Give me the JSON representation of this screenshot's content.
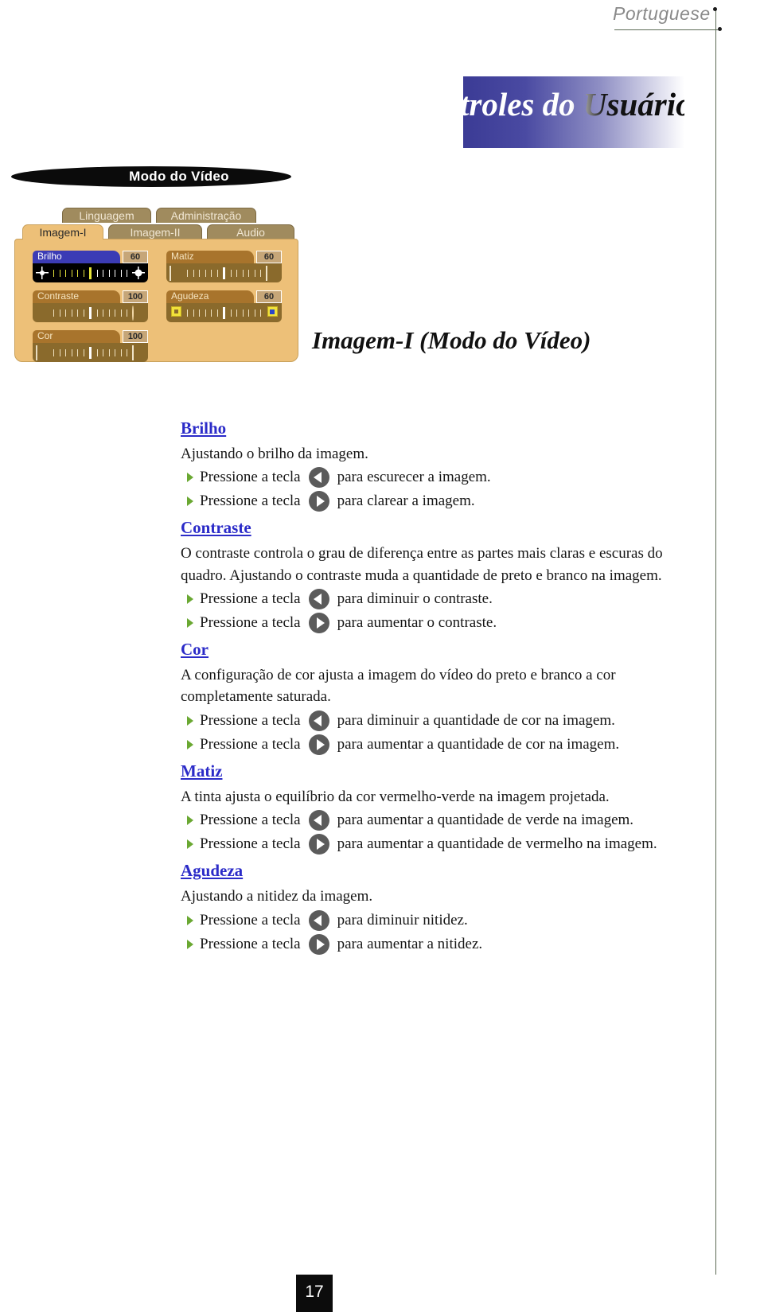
{
  "header": {
    "language_label": "Portuguese",
    "banner_title": "troles do Usuário",
    "mode_banner": "Modo do Vídeo"
  },
  "osd": {
    "tabs": [
      {
        "label": "Linguagem",
        "active": false
      },
      {
        "label": "Administração",
        "active": false
      },
      {
        "label": "Imagem-I",
        "active": true
      },
      {
        "label": "Imagem-II",
        "active": false
      },
      {
        "label": "Audio",
        "active": false
      }
    ],
    "sliders": [
      {
        "name": "Brilho",
        "value": "60",
        "selected": true
      },
      {
        "name": "Contraste",
        "value": "100",
        "selected": false
      },
      {
        "name": "Cor",
        "value": "100",
        "selected": false
      },
      {
        "name": "Matiz",
        "value": "60",
        "selected": false
      },
      {
        "name": "Agudeza",
        "value": "60",
        "selected": false
      }
    ]
  },
  "section_title": "Imagem-I (Modo do Vídeo)",
  "topics": [
    {
      "heading": "Brilho",
      "paragraphs": [
        "Ajustando o brilho da imagem."
      ],
      "steps": [
        {
          "pre": "Pressione a tecla",
          "key": "left-arrow-key",
          "post": "para escurecer a imagem."
        },
        {
          "pre": "Pressione a tecla",
          "key": "right-arrow-key",
          "post": "para clarear a imagem."
        }
      ]
    },
    {
      "heading": "Contraste",
      "paragraphs": [
        "O contraste controla o grau de diferença entre as partes mais claras e escuras do quadro.  Ajustando o contraste muda a quantidade de preto e branco na imagem."
      ],
      "steps": [
        {
          "pre": "Pressione a tecla",
          "key": "left-arrow-key",
          "post": "para diminuir o contraste."
        },
        {
          "pre": "Pressione a tecla",
          "key": "right-arrow-key",
          "post": "para aumentar o contraste."
        }
      ]
    },
    {
      "heading": "Cor",
      "paragraphs": [
        "A configuração de cor ajusta a imagem do vídeo do preto e branco a cor completamente saturada."
      ],
      "steps": [
        {
          "pre": "Pressione a tecla",
          "key": "left-arrow-key",
          "post": "para diminuir a quantidade de cor na imagem."
        },
        {
          "pre": "Pressione a tecla",
          "key": "right-arrow-key",
          "post": "para aumentar a quantidade de cor na imagem."
        }
      ]
    },
    {
      "heading": "Matiz",
      "paragraphs": [
        "A tinta ajusta o equilíbrio da cor vermelho-verde na imagem projetada."
      ],
      "steps": [
        {
          "pre": "Pressione a tecla",
          "key": "left-arrow-key",
          "post": "para aumentar a quantidade de verde na  imagem."
        },
        {
          "pre": "Pressione a tecla",
          "key": "right-arrow-key",
          "post": "para aumentar a quantidade de vermelho na  imagem."
        }
      ]
    },
    {
      "heading": "Agudeza",
      "paragraphs": [
        "Ajustando a nitidez da imagem."
      ],
      "steps": [
        {
          "pre": "Pressione a tecla",
          "key": "left-arrow-key",
          "post": "para diminuir nitidez."
        },
        {
          "pre": "Pressione a tecla",
          "key": "right-arrow-key",
          "post": "para aumentar a nitidez."
        }
      ]
    }
  ],
  "footer": {
    "page_number": "17"
  },
  "colors": {
    "heading_blue": "#2b2bc8",
    "osd_panel": "#edc078",
    "osd_tab": "#a08b5e",
    "osd_selected": "#3b3bb5",
    "bullet_green": "#6aa832",
    "key_button": "#5b5b5b",
    "banner_blue": "#3b3b95"
  }
}
